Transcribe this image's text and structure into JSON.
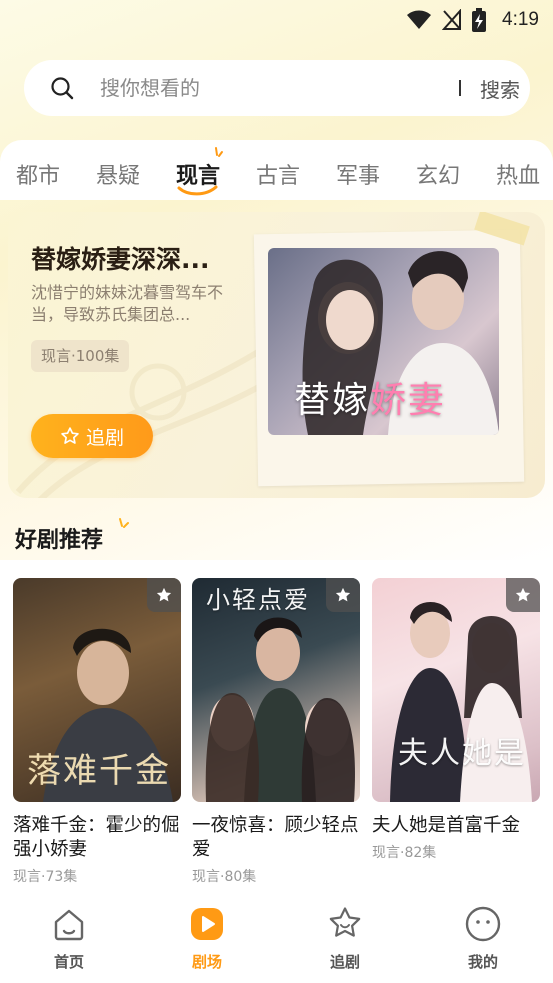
{
  "status_bar": {
    "time": "4:19"
  },
  "search": {
    "placeholder": "搜你想看的",
    "button_label": "搜索"
  },
  "tabs": [
    {
      "label": "都市"
    },
    {
      "label": "悬疑"
    },
    {
      "label": "现言",
      "active": true
    },
    {
      "label": "古言"
    },
    {
      "label": "军事"
    },
    {
      "label": "玄幻"
    },
    {
      "label": "热血"
    }
  ],
  "featured": {
    "title": "替嫁娇妻深深...",
    "description": "沈惜宁的妹妹沈暮雪驾车不当，导致苏氏集团总...",
    "tag": "现言·100集",
    "button_label": "追剧",
    "poster_text_white_1": "替",
    "poster_text_white_2": "嫁",
    "poster_text_pink": "娇妻"
  },
  "section": {
    "title": "好剧推荐"
  },
  "dramas": [
    {
      "title": "落难千金：霍少的倔强小娇妻",
      "meta": "现言·73集",
      "cover_text": "落难千金"
    },
    {
      "title": "一夜惊喜：顾少轻点爱",
      "meta": "现言·80集",
      "cover_text": "小轻点爱"
    },
    {
      "title": "夫人她是首富千金",
      "meta": "现言·82集",
      "cover_text": "夫人她是"
    }
  ],
  "nav": [
    {
      "label": "首页",
      "icon": "home-icon"
    },
    {
      "label": "剧场",
      "icon": "theater-play-icon",
      "active": true
    },
    {
      "label": "追剧",
      "icon": "star-face-icon"
    },
    {
      "label": "我的",
      "icon": "profile-face-icon"
    }
  ],
  "colors": {
    "accent": "#ff9a14",
    "background": "#fbf4cf"
  }
}
